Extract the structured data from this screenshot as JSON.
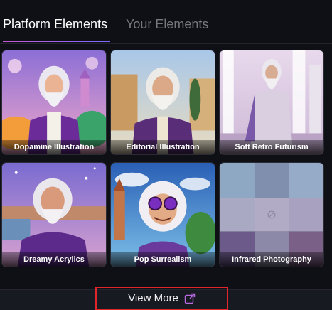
{
  "tabs": {
    "platform_label": "Platform Elements",
    "yours_label": "Your Elements"
  },
  "cards": [
    {
      "label": "Dopamine Illustration"
    },
    {
      "label": "Editorial Illustration"
    },
    {
      "label": "Soft Retro Futurism"
    },
    {
      "label": "Dreamy Acrylics"
    },
    {
      "label": "Pop Surrealism"
    },
    {
      "label": "Infrared Photography"
    }
  ],
  "view_more": {
    "label": "View More",
    "icon": "external-link-icon",
    "highlight_color": "#e0262b"
  },
  "colors": {
    "accent_gradient_start": "#c75bd8",
    "accent_gradient_end": "#7a6cff",
    "background": "#0f1016"
  }
}
